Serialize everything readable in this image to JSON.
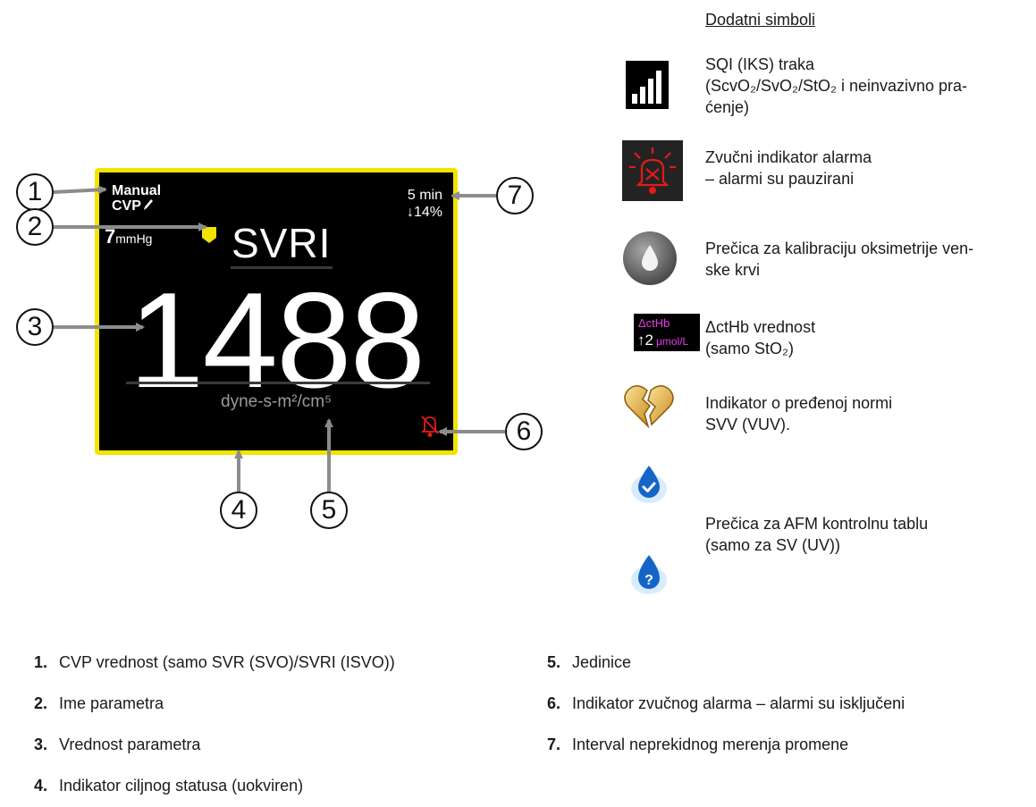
{
  "tile": {
    "cvp_label_line1": "Manual",
    "cvp_label_line2": "CVP",
    "cvp_value": "7",
    "cvp_unit": "mmHg",
    "interval_time": "5 min",
    "interval_change": "↓14%",
    "parameter_name": "SVRI",
    "parameter_value": "1488",
    "units": "dyne-s-m²/cm⁵",
    "target_status_color": "#f2e400"
  },
  "callouts": [
    "1",
    "2",
    "3",
    "4",
    "5",
    "6",
    "7"
  ],
  "symbols": {
    "heading": "Dodatni simboli",
    "items": [
      {
        "icon": "signal-quality-bar-icon",
        "text": [
          "SQI (IKS) traka",
          "(ScvO₂/SvO₂/StO₂ i neinvazivno pra-",
          "ćenje)"
        ]
      },
      {
        "icon": "audible-alarm-paused-icon",
        "text": [
          "Zvučni indikator alarma",
          "– alarmi su pauzirani"
        ]
      },
      {
        "icon": "venous-oximetry-calibration-icon",
        "text": [
          "Prečica za kalibraciju oksimetrije ven-",
          "ske krvi"
        ]
      },
      {
        "icon": "ctHb-value-icon",
        "text": [
          "ΔctHb vrednost",
          "(samo StO₂)"
        ]
      },
      {
        "icon": "broken-heart-icon",
        "text": [
          "Indikator o pređenoj normi",
          "SVV (VUV)."
        ]
      },
      {
        "icon": "afm-dashboard-icon",
        "text": [
          "Prečica za AFM kontrolnu tablu",
          "(samo za SV (UV))"
        ]
      }
    ],
    "ctHb_label": "ΔctHb",
    "ctHb_value": "↑2",
    "ctHb_unit": "μmol/L"
  },
  "legend": [
    {
      "num": "1.",
      "text": "CVP vrednost (samo SVR (SVO)/SVRI (ISVO))"
    },
    {
      "num": "2.",
      "text": "Ime parametra"
    },
    {
      "num": "3.",
      "text": "Vrednost parametra"
    },
    {
      "num": "4.",
      "text": "Indikator ciljnog statusa (uokviren)"
    },
    {
      "num": "5.",
      "text": "Jedinice"
    },
    {
      "num": "6.",
      "text": "Indikator zvučnog alarma – alarmi su isključeni"
    },
    {
      "num": "7.",
      "text": "Interval neprekidnog merenja promene"
    }
  ]
}
